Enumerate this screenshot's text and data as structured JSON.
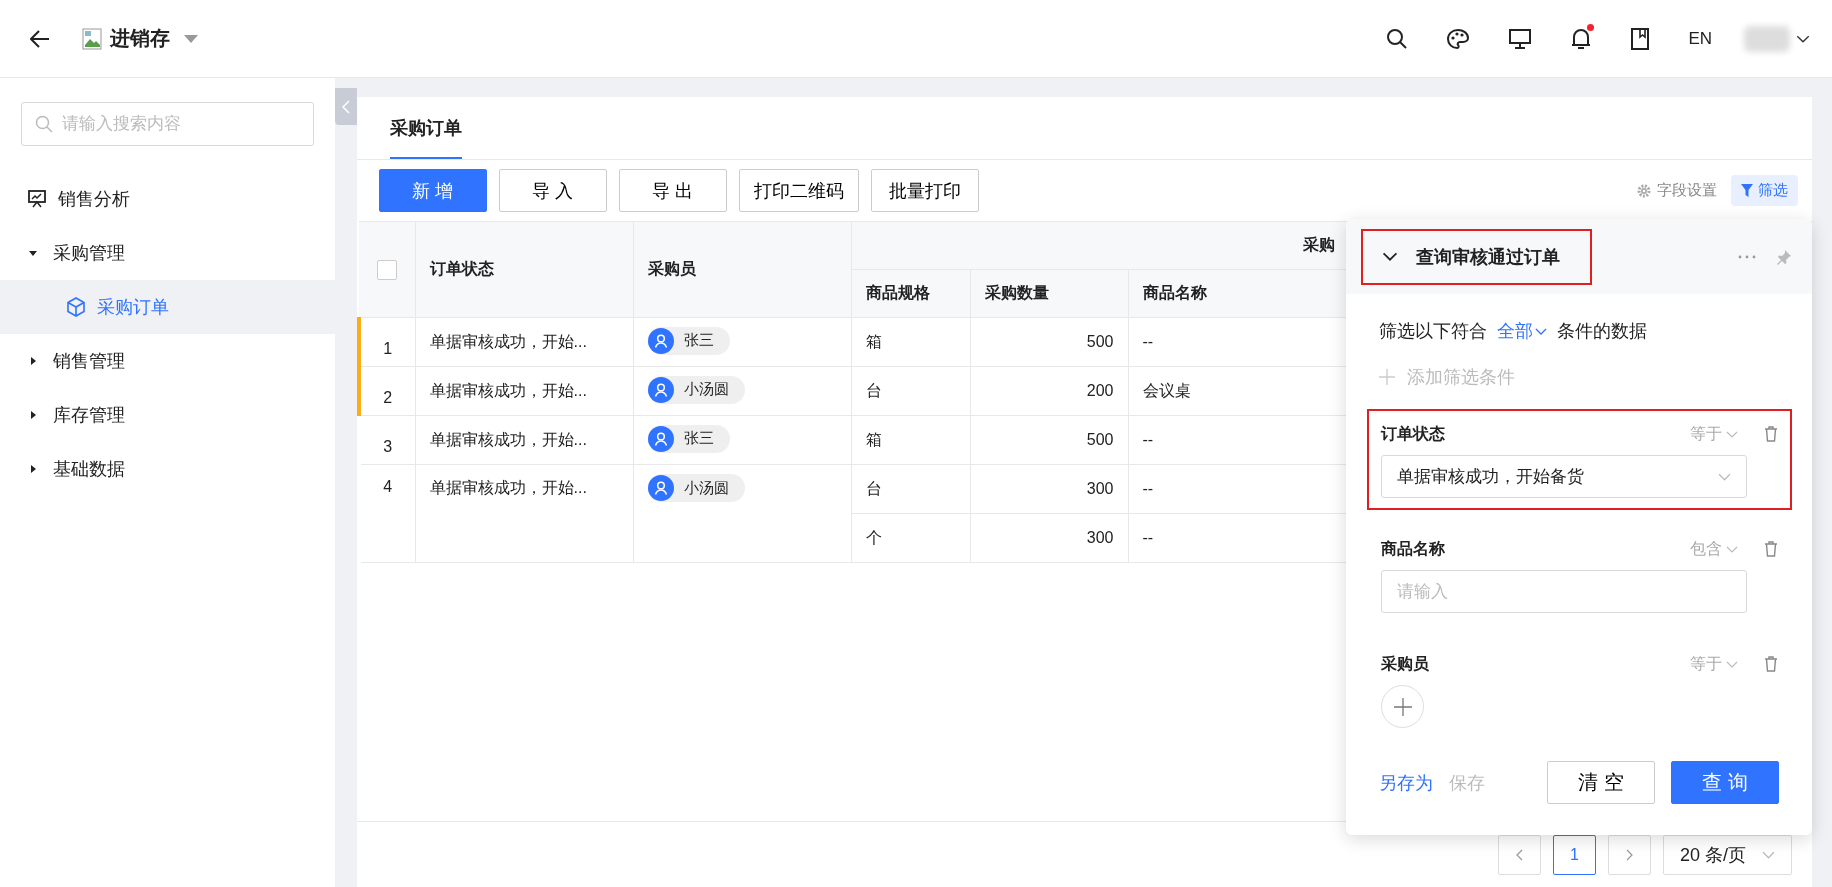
{
  "app": {
    "title": "进销存"
  },
  "top_bar": {
    "language": "EN",
    "notifications_unread": true
  },
  "sidebar": {
    "search": {
      "placeholder": "请输入搜索内容"
    },
    "items": [
      {
        "label": "销售分析",
        "kind": "link",
        "selected": false
      },
      {
        "label": "采购管理",
        "kind": "group",
        "expanded": true,
        "selected": false,
        "children": [
          {
            "label": "采购订单",
            "selected": true
          }
        ]
      },
      {
        "label": "销售管理",
        "kind": "group",
        "expanded": false,
        "selected": false
      },
      {
        "label": "库存管理",
        "kind": "group",
        "expanded": false,
        "selected": false
      },
      {
        "label": "基础数据",
        "kind": "group",
        "expanded": false,
        "selected": false
      }
    ]
  },
  "tabs": [
    {
      "label": "采购订单",
      "selected": true
    }
  ],
  "toolbar": {
    "buttons": [
      {
        "label": "新 增",
        "kind": "primary"
      },
      {
        "label": "导 入",
        "kind": "default"
      },
      {
        "label": "导 出",
        "kind": "default"
      },
      {
        "label": "打印二维码",
        "kind": "default"
      },
      {
        "label": "批量打印",
        "kind": "default"
      }
    ],
    "field_settings": "字段设置",
    "filter": {
      "label": "筛选",
      "active": true
    }
  },
  "table": {
    "select_all": {
      "checked": false
    },
    "columns": [
      "订单状态",
      "采购员"
    ],
    "group_header": "采购",
    "sub_columns": [
      "商品规格",
      "采购数量",
      "商品名称"
    ],
    "rows": [
      {
        "index": "1",
        "status": "单据审核成功，开始...",
        "buyer": "张三",
        "flagged": true,
        "items": [
          {
            "spec": "箱",
            "qty": "500",
            "name": "--"
          }
        ]
      },
      {
        "index": "2",
        "status": "单据审核成功，开始...",
        "buyer": "小汤圆",
        "flagged": true,
        "items": [
          {
            "spec": "台",
            "qty": "200",
            "name": "会议桌"
          }
        ]
      },
      {
        "index": "3",
        "status": "单据审核成功，开始...",
        "buyer": "张三",
        "flagged": false,
        "items": [
          {
            "spec": "箱",
            "qty": "500",
            "name": "--"
          }
        ]
      },
      {
        "index": "4",
        "status": "单据审核成功，开始...",
        "buyer": "小汤圆",
        "flagged": false,
        "items": [
          {
            "spec": "台",
            "qty": "300",
            "name": "--"
          },
          {
            "spec": "个",
            "qty": "300",
            "name": "--"
          }
        ]
      }
    ]
  },
  "filter_panel": {
    "title": {
      "text": "查询审核通过订单",
      "highlighted": true
    },
    "match": {
      "prefix": "筛选以下符合",
      "mode": "全部",
      "suffix": "条件的数据"
    },
    "add_condition": "添加筛选条件",
    "conditions": [
      {
        "field": "订单状态",
        "operator": "等于",
        "kind": "select",
        "value": "单据审核成功，开始备货",
        "highlighted": true
      },
      {
        "field": "商品名称",
        "operator": "包含",
        "kind": "text",
        "placeholder": "请输入",
        "highlighted": false
      },
      {
        "field": "采购员",
        "operator": "等于",
        "kind": "person",
        "highlighted": false
      }
    ],
    "save_as": "另存为",
    "save": {
      "label": "保存",
      "disabled": true
    },
    "buttons": [
      {
        "label": "清 空",
        "kind": "default"
      },
      {
        "label": "查 询",
        "kind": "primary"
      }
    ]
  },
  "pagination": {
    "pages": [
      {
        "label": "1",
        "selected": true
      }
    ],
    "page_size": "20 条/页"
  }
}
